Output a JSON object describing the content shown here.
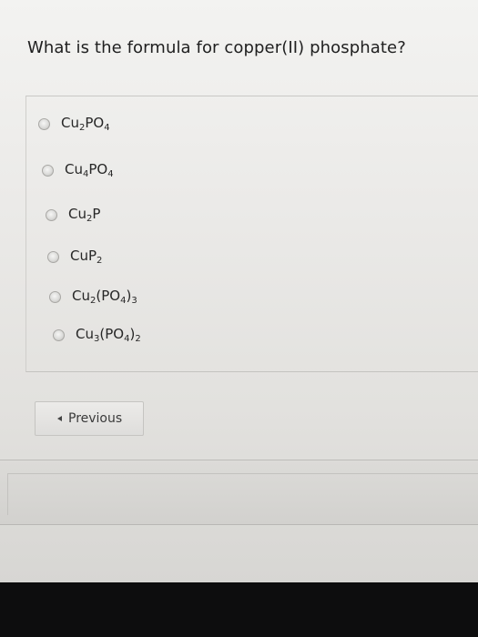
{
  "question": {
    "text": "What is the formula for copper(II) phosphate?"
  },
  "options": [
    {
      "label": "Cu2PO4",
      "selected": false
    },
    {
      "label": "Cu4PO4",
      "selected": false
    },
    {
      "label": "Cu2P",
      "selected": false
    },
    {
      "label": "CuP2",
      "selected": false
    },
    {
      "label": "Cu2(PO4)3",
      "selected": false
    },
    {
      "label": "Cu3(PO4)2",
      "selected": false
    }
  ],
  "navigation": {
    "previous_label": "Previous",
    "previous_icon": "triangle-left-icon"
  }
}
